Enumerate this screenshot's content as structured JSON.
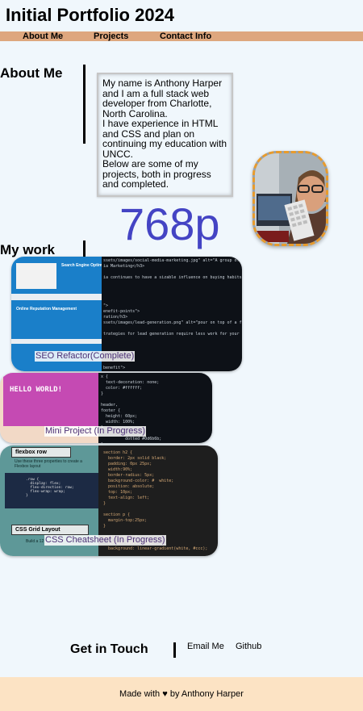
{
  "header": {
    "title": "Initial Portfolio 2024"
  },
  "nav": {
    "about": "About Me",
    "projects": "Projects",
    "contact": "Contact Info"
  },
  "about": {
    "heading": "About Me",
    "bio_1": "My name is Anthony Harper and I am a full stack web developer from Charlotte, North Carolina.",
    "bio_2": "I have experience in HTML and CSS and plan on continuing my education with UNCC.",
    "bio_3": "Below are some of my projects, both in progress and completed."
  },
  "viewport_readout": "768p",
  "work": {
    "heading": "My work",
    "projects": [
      {
        "label": "SEO Refactor(Complete)"
      },
      {
        "label": "Mini Project (In Progress)"
      },
      {
        "label": "CSS Cheatsheet (In Progress)"
      }
    ],
    "thumb1": {
      "heading_1": "Search Engine Optim",
      "heading_2": "Online Reputation Management",
      "code": "ssets/images/social-media-marketing.jpg\" alt=\"A group of people\nia Marketing</h3>\n\nia continues to have a sizable influence on buying habits. Social\n\n\n\n\n\">\nenefit-points\">\nration/h3>\nssets/images/lead-generation.png\" alt=\"pour on top of a funnel wit\n\ntrategies for lead generation require less work for your business,\n\n\n\n\n\nbenefit\">\nssets/images/..."
    },
    "thumb2": {
      "hello": "HELLO WORLD!",
      "code": "x {\n  text-decoration: none;\n  color: #ffffff;\n}\n\nheader,\nfooter {\n  height: 60px;\n  width: 100%;\n}\n\n          dotted #0d6b6b;\n}"
    },
    "thumb3": {
      "flexbox": "flexbox row",
      "flex_text": "Use these three properties to create a Flexbox layout",
      "flex_code": ".row {\n  display: flex;\n  flex-direction: row;\n  flex-wrap: wrap;\n}",
      "grid": "CSS Grid Layout",
      "grid_text": "Build a 12",
      "code": "section h2 {\n  border: 2px solid black;\n  padding: 0px 25px;\n  width:90%;\n  border-radius: 5px;\n  background-color: #  white;\n  position: absolute;\n  top: 10px;\n  text-align: left;\n}\n\nsection p {\n  margin-top:25px;\n}\n\nsection code {\n  border-radius: 5px;\n  background: linear-gradient(white, #ccc);"
    }
  },
  "contact": {
    "heading": "Get in Touch",
    "email": "Email Me",
    "github": "Github"
  },
  "footer": {
    "made_with": "Made with",
    "heart": "♥",
    "by": "by Anthony Harper"
  }
}
